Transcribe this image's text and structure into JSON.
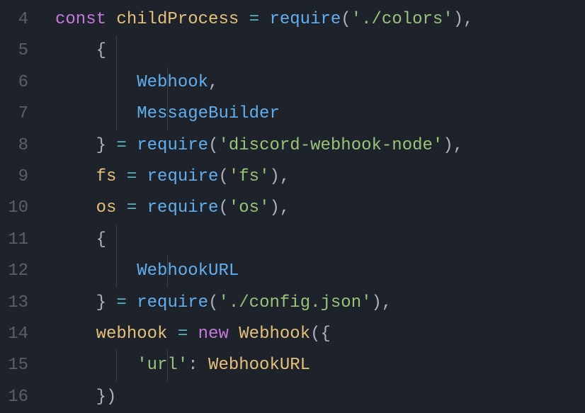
{
  "lineNumbers": [
    "4",
    "5",
    "6",
    "7",
    "8",
    "9",
    "10",
    "11",
    "12",
    "13",
    "14",
    "15",
    "16"
  ],
  "code": {
    "l4": {
      "kw_const": "const",
      "var_childProcess": "childProcess",
      "op_eq": " = ",
      "fn_require": "require",
      "paren_open": "(",
      "str_colors": "'./colors'",
      "paren_close_comma": "),"
    },
    "l5": {
      "brace_open": "    {"
    },
    "l6": {
      "prop_webhook": "Webhook",
      "comma": ","
    },
    "l7": {
      "prop_msgbuilder": "MessageBuilder"
    },
    "l8": {
      "brace_close": "    }",
      "op_eq": " = ",
      "fn_require": "require",
      "paren_open": "(",
      "str_discord": "'discord-webhook-node'",
      "paren_close_comma": "),"
    },
    "l9": {
      "var_fs": "    fs",
      "op_eq": " = ",
      "fn_require": "require",
      "paren_open": "(",
      "str_fs": "'fs'",
      "paren_close_comma": "),"
    },
    "l10": {
      "var_os": "    os",
      "op_eq": " = ",
      "fn_require": "require",
      "paren_open": "(",
      "str_os": "'os'",
      "paren_close_comma": "),"
    },
    "l11": {
      "brace_open": "    {"
    },
    "l12": {
      "prop_webhookurl": "WebhookURL"
    },
    "l13": {
      "brace_close": "    }",
      "op_eq": " = ",
      "fn_require": "require",
      "paren_open": "(",
      "str_config": "'./config.json'",
      "paren_close_comma": "),"
    },
    "l14": {
      "var_webhook": "    webhook",
      "op_eq": " = ",
      "kw_new": "new",
      "sp": " ",
      "cls_webhook": "Webhook",
      "paren_brace_open": "({"
    },
    "l15": {
      "key_url": "'url'",
      "colon": ": ",
      "val_webhookurl": "WebhookURL"
    },
    "l16": {
      "brace_paren_close": "    })"
    }
  }
}
